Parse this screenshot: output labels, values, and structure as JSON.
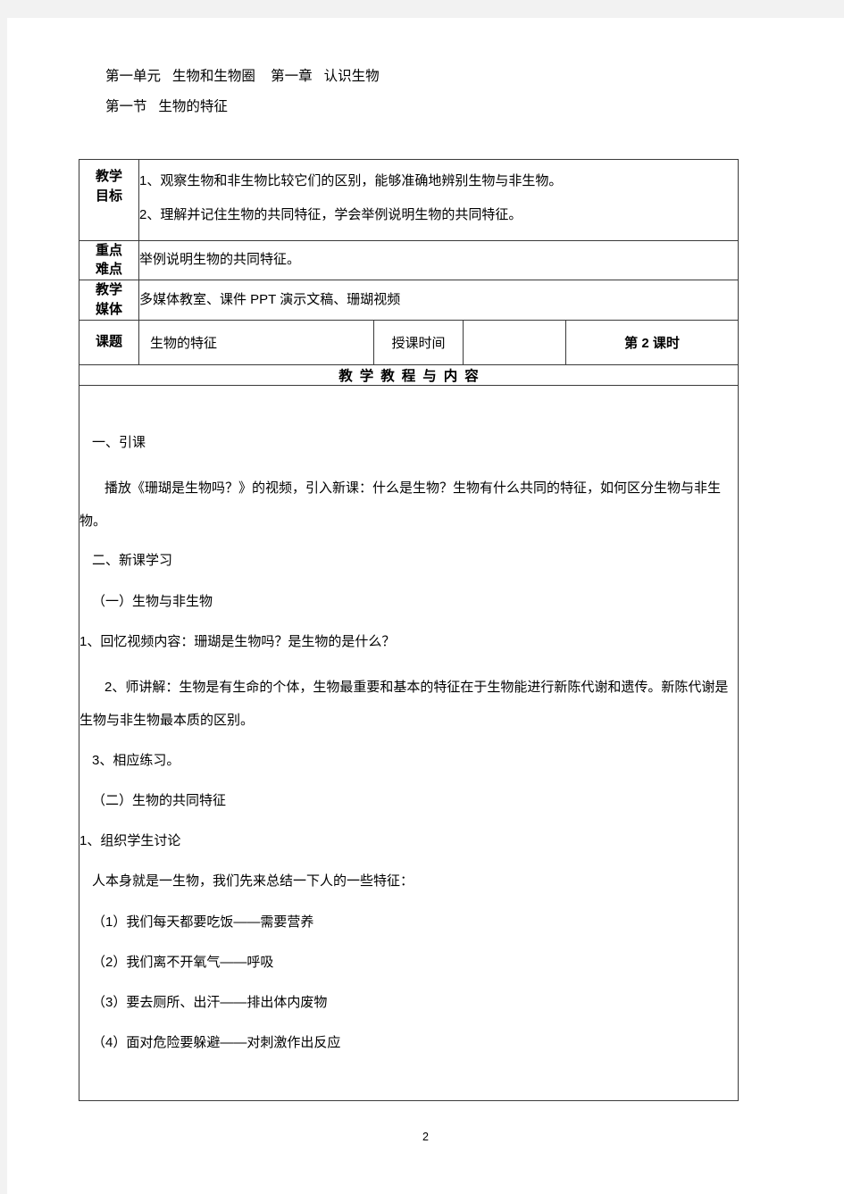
{
  "document": {
    "header": {
      "line1": "第一单元   生物和生物圈    第一章   认识生物",
      "line2": "第一节   生物的特征"
    },
    "table": {
      "rows": {
        "goal": {
          "label_line1": "教学",
          "label_line2": "目标",
          "items": [
            "1、观察生物和非生物比较它们的区别，能够准确地辨别生物与非生物。",
            "2、理解并记住生物的共同特征，学会举例说明生物的共同特征。"
          ]
        },
        "focus": {
          "label_line1": "重点",
          "label_line2": "难点",
          "value": "举例说明生物的共同特征。"
        },
        "media": {
          "label_line1": "教学",
          "label_line2": "媒体",
          "value": "多媒体教室、课件 PPT 演示文稿、珊瑚视频"
        },
        "topic": {
          "label": "课题",
          "value": "生物的特征",
          "time_label": "授课时间",
          "time_value": "",
          "period": "第 2 课时"
        }
      },
      "section_header": "教学教程与内容",
      "content": [
        "一、引课",
        "播放《珊瑚是生物吗？》的视频，引入新课：什么是生物？生物有什么共同的特征，如何区分生物与非生物。",
        "二、新课学习",
        "（一）生物与非生物",
        "1、回忆视频内容：珊瑚是生物吗？是生物的是什么？",
        "2、师讲解：生物是有生命的个体，生物最重要和基本的特征在于生物能进行新陈代谢和遗传。新陈代谢是生物与非生物最本质的区别。",
        "3、相应练习。",
        "（二）生物的共同特征",
        "1、组织学生讨论",
        "人本身就是一生物，我们先来总结一下人的一些特征：",
        "（1）我们每天都要吃饭——需要营养",
        "（2）我们离不开氧气——呼吸",
        "（3）要去厕所、出汗——排出体内废物",
        "（4）面对危险要躲避——对刺激作出反应"
      ]
    },
    "page_number": "2"
  }
}
